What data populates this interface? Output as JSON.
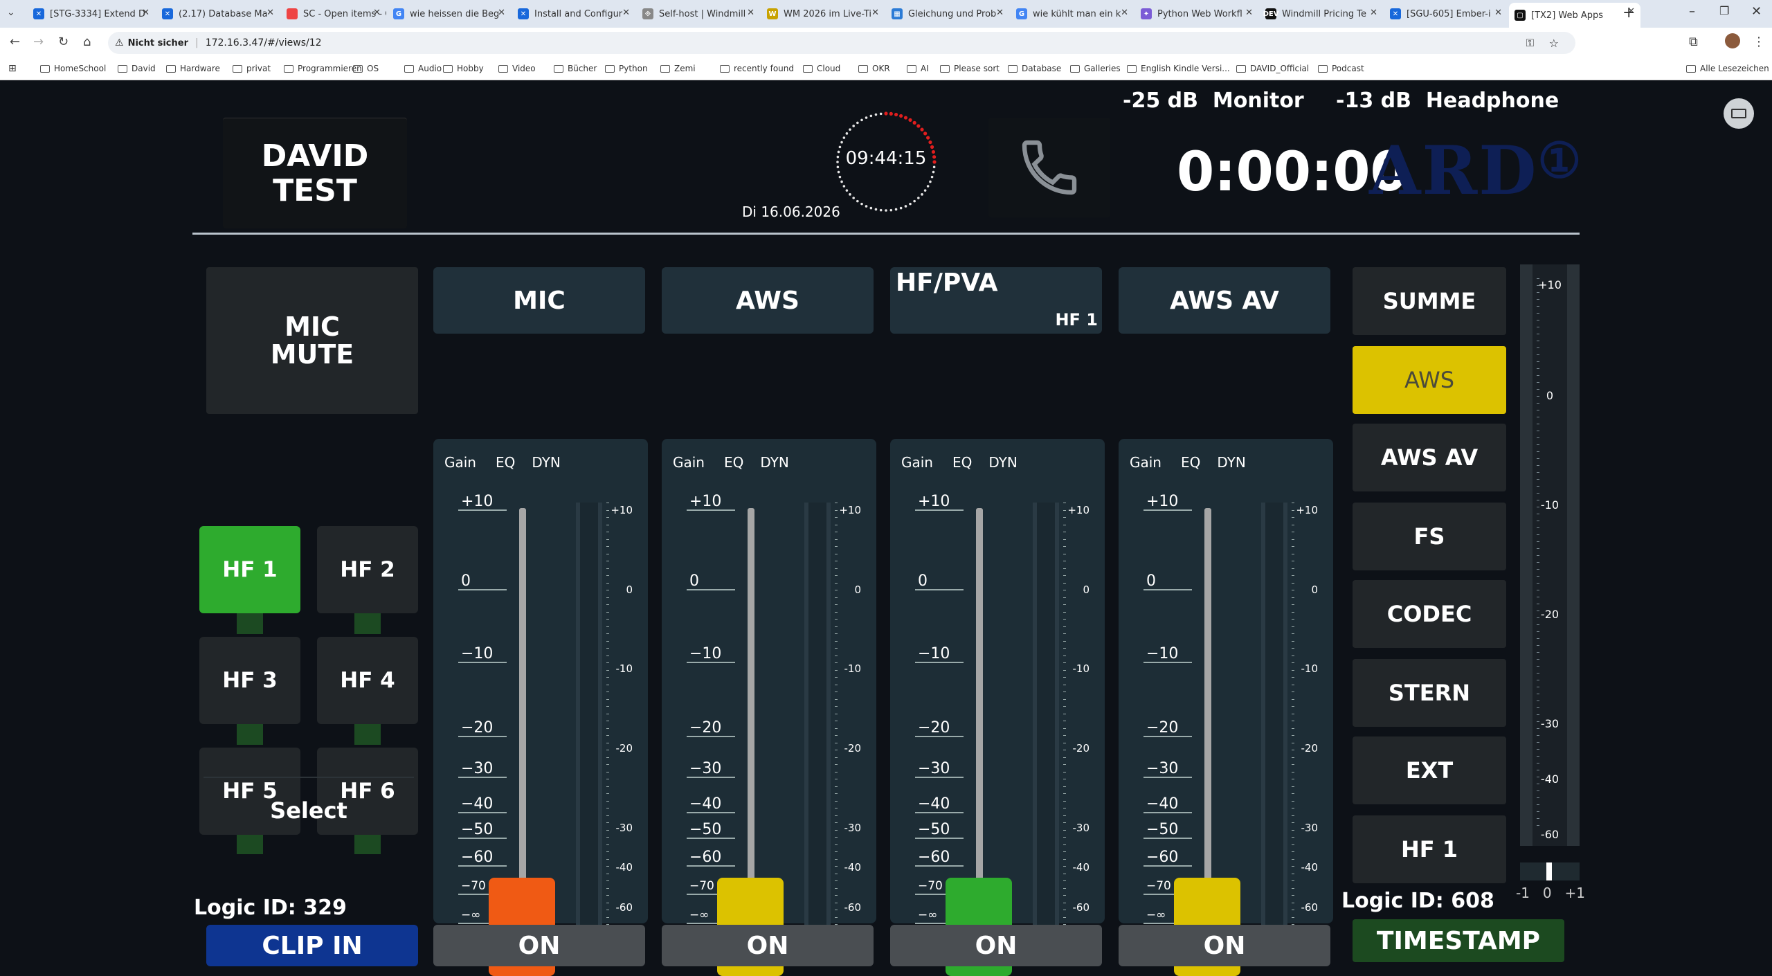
{
  "browser": {
    "tabs": [
      {
        "label": "[STG-3334] Extend D",
        "color": "#1868db",
        "glyph": "✕"
      },
      {
        "label": "(2.17) Database Ma",
        "color": "#1868db",
        "glyph": "✕"
      },
      {
        "label": "SC - Open items - C",
        "color": "#e44",
        "glyph": ""
      },
      {
        "label": "wie heissen die Beg",
        "color": "#4285f4",
        "glyph": "G"
      },
      {
        "label": "Install and Configur",
        "color": "#1868db",
        "glyph": "✕"
      },
      {
        "label": "Self-host | Windmill",
        "color": "#888",
        "glyph": "⟐"
      },
      {
        "label": "WM 2026 im Live-Ti",
        "color": "#c8a200",
        "glyph": "W"
      },
      {
        "label": "Gleichung und Prob",
        "color": "#2b7bd6",
        "glyph": "▦"
      },
      {
        "label": "wie kühlt man ein k",
        "color": "#4285f4",
        "glyph": "G"
      },
      {
        "label": "Python Web Workfl",
        "color": "#7b5cd6",
        "glyph": "✦"
      },
      {
        "label": "Windmill Pricing Te",
        "color": "#111",
        "glyph": "DEV"
      },
      {
        "label": "[SGU-605] Ember-i",
        "color": "#1868db",
        "glyph": "✕"
      },
      {
        "label": "[TX2] Web Apps",
        "color": "#111",
        "glyph": "▢"
      }
    ],
    "security": "Nicht sicher",
    "url": "172.16.3.47/#/views/12",
    "bookmarks": [
      "HomeSchool",
      "David",
      "Hardware",
      "privat",
      "Programmieren",
      "OS",
      "Audio",
      "Hobby",
      "Video",
      "Bücher",
      "Python",
      "Zemi",
      "recently found",
      "Cloud",
      "OKR",
      "AI",
      "Please sort",
      "Database",
      "Galleries",
      "English Kindle Versi...",
      "DAVID_Official",
      "Podcast"
    ],
    "all_bookmarks": "Alle Lesezeichen"
  },
  "header": {
    "name_line1": "DAVID",
    "name_line2": "TEST",
    "clock": "09:44:15",
    "date": "Di 16.06.2026",
    "monitor_db": "-25 dB",
    "monitor_label": "Monitor",
    "headphone_db": "-13 dB",
    "headphone_label": "Headphone",
    "timer": "0:00:00",
    "logo": "ARD"
  },
  "left": {
    "mic_mute_line1": "MIC",
    "mic_mute_line2": "MUTE",
    "hf_buttons": [
      "HF 1",
      "HF 2",
      "HF 3",
      "HF 4",
      "HF 5",
      "HF 6"
    ],
    "hf_active": "HF 1",
    "select_label": "Select",
    "logic_id": "Logic ID: 329",
    "clip_in": "CLIP IN",
    "active_color": "#2eab2e"
  },
  "channels": [
    {
      "name": "MIC",
      "sub": "",
      "knob_color": "#f05a14",
      "on": "ON"
    },
    {
      "name": "AWS",
      "sub": "",
      "knob_color": "#dcc200",
      "on": "ON"
    },
    {
      "name": "HF/PVA",
      "sub": "HF 1",
      "knob_color": "#2eab2e",
      "on": "ON"
    },
    {
      "name": "AWS AV",
      "sub": "",
      "knob_color": "#dcc200",
      "on": "ON"
    }
  ],
  "strip_tabs": [
    "Gain",
    "EQ",
    "DYN"
  ],
  "fader_scale": [
    "+10",
    "0",
    "−10",
    "−20",
    "−30",
    "−40",
    "−50",
    "−60",
    "−70",
    "−∞"
  ],
  "meter_scale": [
    "+10",
    "0",
    "-10",
    "-20",
    "-30",
    "-40",
    "-60"
  ],
  "right": {
    "buttons": [
      "SUMME",
      "AWS",
      "AWS AV",
      "FS",
      "CODEC",
      "STERN",
      "EXT",
      "HF 1"
    ],
    "active": "AWS",
    "active_color": "#dcc200",
    "meter_scale": [
      "+10",
      "0",
      "-10",
      "-20",
      "-30",
      "-40",
      "-60"
    ],
    "balance": [
      "-1",
      "0",
      "+1"
    ],
    "logic_id": "Logic ID: 608",
    "timestamp": "TIMESTAMP"
  }
}
